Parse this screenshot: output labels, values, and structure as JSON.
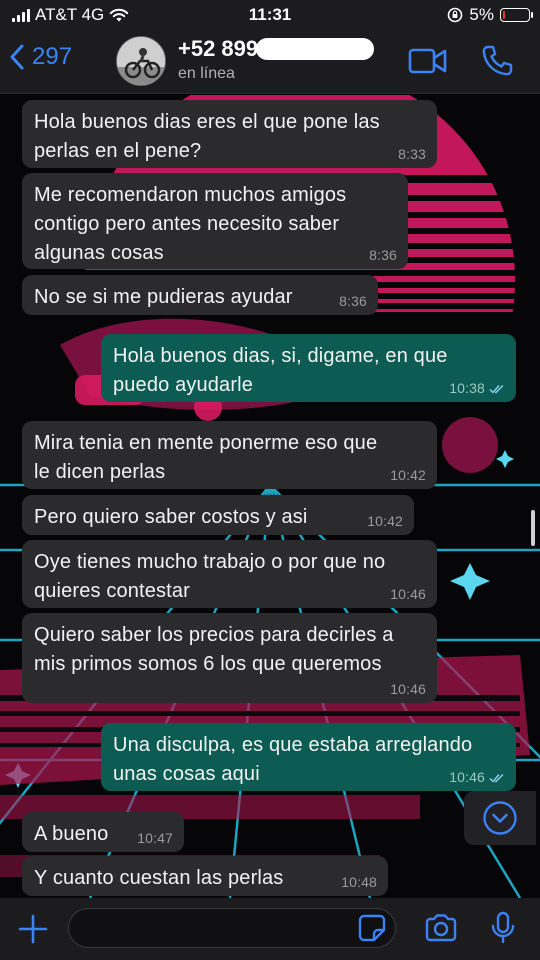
{
  "status_bar": {
    "carrier": "AT&T 4G",
    "time": "11:31",
    "battery": "5%"
  },
  "header": {
    "back_count": "297",
    "contact_number": "+52 899",
    "presence": "en línea"
  },
  "messages": [
    {
      "direction": "in",
      "text_lines": [
        "Hola buenos dias eres el que pone las",
        "perlas en el pene?"
      ],
      "time": "8:33"
    },
    {
      "direction": "in",
      "text_lines": [
        "Me recomendaron muchos amigos",
        "contigo pero antes necesito saber",
        "algunas cosas"
      ],
      "time": "8:36"
    },
    {
      "direction": "in",
      "text_lines": [
        "No se si me pudieras ayudar"
      ],
      "time": "8:36"
    },
    {
      "direction": "out",
      "text_lines": [
        "Hola buenos dias, si, digame, en que",
        "puedo ayudarle"
      ],
      "time": "10:38",
      "read": true
    },
    {
      "direction": "in",
      "text_lines": [
        "Mira tenia en mente ponerme eso que",
        "le dicen perlas"
      ],
      "time": "10:42"
    },
    {
      "direction": "in",
      "text_lines": [
        "Pero quiero saber costos y asi"
      ],
      "time": "10:42"
    },
    {
      "direction": "in",
      "text_lines": [
        "Oye tienes mucho trabajo o por que no",
        "quieres contestar"
      ],
      "time": "10:46"
    },
    {
      "direction": "in",
      "text_lines": [
        "Quiero saber los precios para decirles a",
        "mis primos somos 6 los que queremos"
      ],
      "time": "10:46"
    },
    {
      "direction": "out",
      "text_lines": [
        "Una disculpa, es que estaba arreglando",
        "unas cosas aqui"
      ],
      "time": "10:46",
      "read": true
    },
    {
      "direction": "in",
      "text_lines": [
        "A bueno"
      ],
      "time": "10:47"
    },
    {
      "direction": "in",
      "text_lines": [
        "Y cuanto cuestan las perlas"
      ],
      "time": "10:48"
    }
  ],
  "composer": {
    "placeholder": ""
  },
  "icons": {
    "back": "chevron-left-icon",
    "video": "video-call-icon",
    "phone": "phone-icon",
    "scroll": "chevron-down-circle-icon",
    "attach": "plus-icon",
    "sticker": "sticker-icon",
    "camera": "camera-icon",
    "mic": "microphone-icon"
  },
  "colors": {
    "accent": "#3b82f6",
    "incoming_bubble": "#2b2b2e",
    "outgoing_bubble": "#0c5c54",
    "read_ticks": "#8fd3f4",
    "wallpaper_magenta": "#c2185b",
    "wallpaper_cyan": "#1fb6d6"
  }
}
